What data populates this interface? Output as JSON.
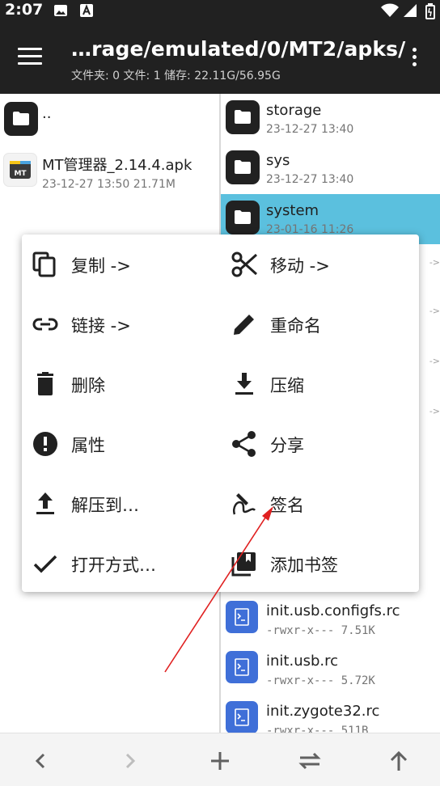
{
  "status": {
    "time": "2:07"
  },
  "appbar": {
    "path": "…rage/emulated/0/MT2/apks/",
    "info": "文件夹: 0  文件: 1  储存: 22.11G/56.95G"
  },
  "left_pane": {
    "items": [
      {
        "name": "..",
        "meta": ""
      },
      {
        "name": "MT管理器_2.14.4.apk",
        "meta": "23-12-27 13:50  21.71M"
      }
    ]
  },
  "right_pane": {
    "items": [
      {
        "name": "storage",
        "meta": "23-12-27 13:40"
      },
      {
        "name": "sys",
        "meta": "23-12-27 13:40"
      },
      {
        "name": "system",
        "meta": "23-01-16 11:26"
      },
      {
        "name": "init.usb.configfs.rc",
        "meta": "-rwxr-x---  7.51K"
      },
      {
        "name": "init.usb.rc",
        "meta": "-rwxr-x---  5.72K"
      },
      {
        "name": "init.zygote32.rc",
        "meta": "-rwxr-x---  511B"
      }
    ],
    "arrow_hint": "->"
  },
  "context_menu": {
    "items": [
      {
        "label": "复制 ->",
        "icon": "copy-icon"
      },
      {
        "label": "移动 ->",
        "icon": "scissors-icon"
      },
      {
        "label": "链接 ->",
        "icon": "link-icon"
      },
      {
        "label": "重命名",
        "icon": "pencil-icon"
      },
      {
        "label": "删除",
        "icon": "trash-icon"
      },
      {
        "label": "压缩",
        "icon": "download-icon"
      },
      {
        "label": "属性",
        "icon": "info-alert-icon"
      },
      {
        "label": "分享",
        "icon": "share-icon"
      },
      {
        "label": "解压到…",
        "icon": "upload-icon"
      },
      {
        "label": "签名",
        "icon": "signature-icon"
      },
      {
        "label": "打开方式…",
        "icon": "check-icon"
      },
      {
        "label": "添加书签",
        "icon": "bookmark-add-icon"
      }
    ]
  },
  "bottom_bar": {
    "buttons": [
      "back-icon",
      "forward-icon",
      "add-icon",
      "swap-icon",
      "up-icon"
    ]
  },
  "colors": {
    "appbar": "#212121",
    "selected_row": "#5bc0de",
    "script_icon": "#3f6fd8",
    "annotation_arrow": "#e02020"
  }
}
